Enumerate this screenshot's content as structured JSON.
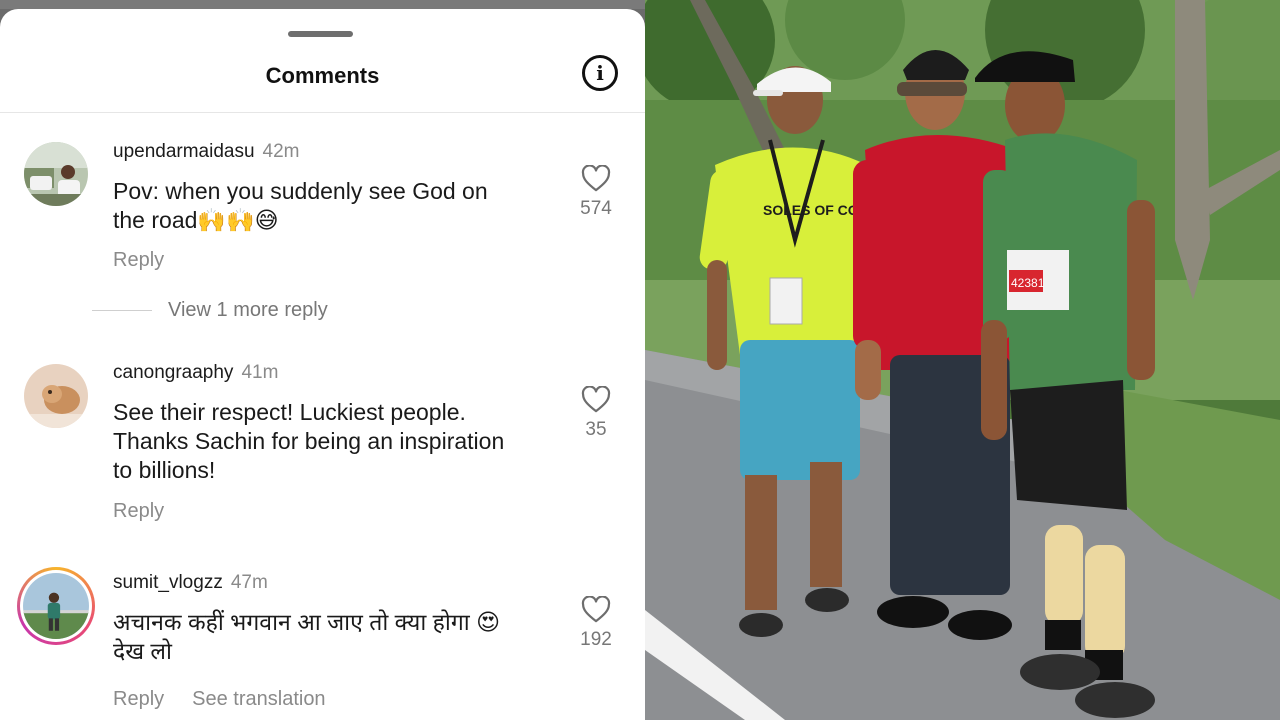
{
  "sheet": {
    "title": "Comments",
    "info_icon": "info-icon"
  },
  "comments": [
    {
      "username": "upendarmaidasu",
      "time": "42m",
      "text_line1": "Pov: when you suddenly see God on",
      "text_line2": "the road🙌🙌😅",
      "reply_label": "Reply",
      "likes": "574",
      "more_replies": "View 1 more reply"
    },
    {
      "username": "canongraaphy",
      "time": "41m",
      "text_line1": "See their respect! Luckiest people.",
      "text_line2": "Thanks Sachin for being an inspiration",
      "text_line3": "to billions!",
      "reply_label": "Reply",
      "likes": "35"
    },
    {
      "username": "sumit_vlogzz",
      "time": "47m",
      "text_line1": "अचानक कहीं भगवान आ जाए तो क्या होगा 😍",
      "text_line2": "देख लो",
      "reply_label": "Reply",
      "translation_label": "See translation",
      "likes": "192"
    }
  ],
  "photo": {
    "bib_number": "42381",
    "shirt_text": "SOLES OF COCHIN"
  },
  "colors": {
    "sheet_bg": "#ffffff",
    "text": "#1a1a1a",
    "muted": "#8a8a8a",
    "story_ring": "#c837ab"
  }
}
